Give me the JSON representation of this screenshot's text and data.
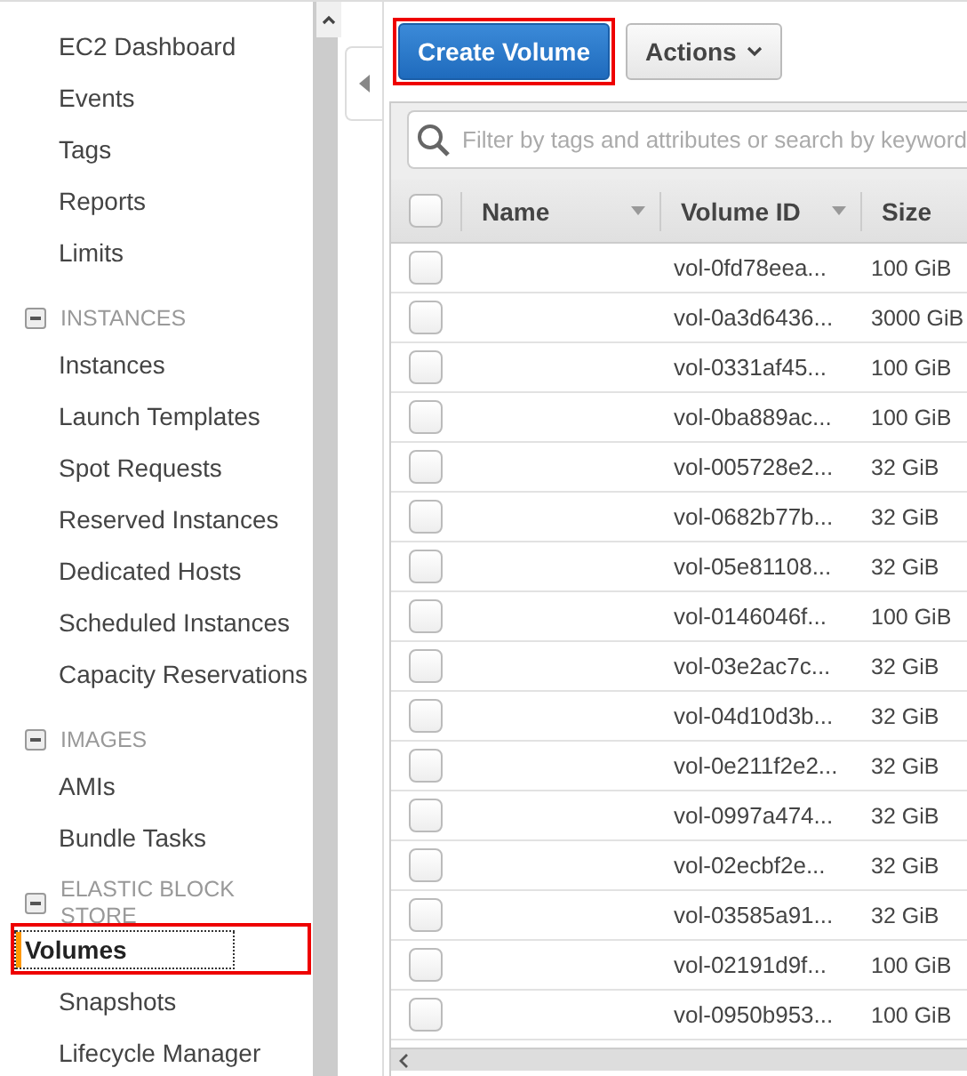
{
  "sidebar": {
    "sections": [
      {
        "items": [
          {
            "label": "EC2 Dashboard",
            "selected": false
          },
          {
            "label": "Events",
            "selected": false
          },
          {
            "label": "Tags",
            "selected": false
          },
          {
            "label": "Reports",
            "selected": false
          },
          {
            "label": "Limits",
            "selected": false
          }
        ]
      },
      {
        "heading": "INSTANCES",
        "expanded": true,
        "items": [
          {
            "label": "Instances",
            "selected": false
          },
          {
            "label": "Launch Templates",
            "selected": false
          },
          {
            "label": "Spot Requests",
            "selected": false
          },
          {
            "label": "Reserved Instances",
            "selected": false
          },
          {
            "label": "Dedicated Hosts",
            "selected": false
          },
          {
            "label": "Scheduled Instances",
            "selected": false
          },
          {
            "label": "Capacity Reservations",
            "selected": false
          }
        ]
      },
      {
        "heading": "IMAGES",
        "expanded": true,
        "items": [
          {
            "label": "AMIs",
            "selected": false
          },
          {
            "label": "Bundle Tasks",
            "selected": false
          }
        ]
      },
      {
        "heading": "ELASTIC BLOCK STORE",
        "expanded": true,
        "items": [
          {
            "label": "Volumes",
            "selected": true,
            "highlighted": true
          },
          {
            "label": "Snapshots",
            "selected": false
          },
          {
            "label": "Lifecycle Manager",
            "selected": false
          }
        ]
      }
    ]
  },
  "toolbar": {
    "primary_button": {
      "label": "Create Volume",
      "highlighted": true
    },
    "actions_button": {
      "label": "Actions"
    }
  },
  "search": {
    "placeholder": "Filter by tags and attributes or search by keyword"
  },
  "table": {
    "select_all_checked": false,
    "columns": [
      "Name",
      "Volume ID",
      "Size"
    ],
    "rows": [
      {
        "checked": false,
        "name": "",
        "volume_id": "vol-0fd78eea...",
        "size": "100 GiB"
      },
      {
        "checked": false,
        "name": "",
        "volume_id": "vol-0a3d6436...",
        "size": "3000 GiB"
      },
      {
        "checked": false,
        "name": "",
        "volume_id": "vol-0331af45...",
        "size": "100 GiB"
      },
      {
        "checked": false,
        "name": "",
        "volume_id": "vol-0ba889ac...",
        "size": "100 GiB"
      },
      {
        "checked": false,
        "name": "",
        "volume_id": "vol-005728e2...",
        "size": "32 GiB"
      },
      {
        "checked": false,
        "name": "",
        "volume_id": "vol-0682b77b...",
        "size": "32 GiB"
      },
      {
        "checked": false,
        "name": "",
        "volume_id": "vol-05e81108...",
        "size": "32 GiB"
      },
      {
        "checked": false,
        "name": "",
        "volume_id": "vol-0146046f...",
        "size": "100 GiB"
      },
      {
        "checked": false,
        "name": "",
        "volume_id": "vol-03e2ac7c...",
        "size": "32 GiB"
      },
      {
        "checked": false,
        "name": "",
        "volume_id": "vol-04d10d3b...",
        "size": "32 GiB"
      },
      {
        "checked": false,
        "name": "",
        "volume_id": "vol-0e211f2e2...",
        "size": "32 GiB"
      },
      {
        "checked": false,
        "name": "",
        "volume_id": "vol-0997a474...",
        "size": "32 GiB"
      },
      {
        "checked": false,
        "name": "",
        "volume_id": "vol-02ecbf2e...",
        "size": "32 GiB"
      },
      {
        "checked": false,
        "name": "",
        "volume_id": "vol-03585a91...",
        "size": "32 GiB"
      },
      {
        "checked": false,
        "name": "",
        "volume_id": "vol-02191d9f...",
        "size": "100 GiB"
      },
      {
        "checked": false,
        "name": "",
        "volume_id": "vol-0950b953...",
        "size": "100 GiB"
      }
    ]
  }
}
